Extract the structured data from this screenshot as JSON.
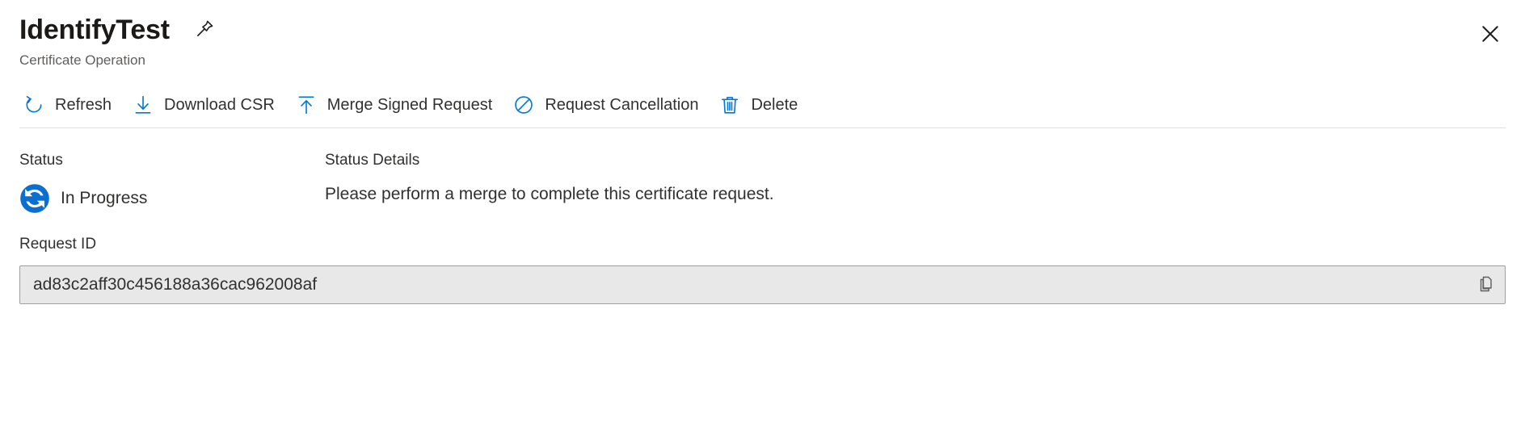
{
  "header": {
    "title": "IdentifyTest",
    "subtitle": "Certificate Operation",
    "pin_icon": "pin-icon",
    "close_icon": "close-icon"
  },
  "commandbar": {
    "buttons": [
      {
        "label": "Refresh",
        "icon": "refresh-icon"
      },
      {
        "label": "Download CSR",
        "icon": "download-icon"
      },
      {
        "label": "Merge Signed Request",
        "icon": "upload-icon"
      },
      {
        "label": "Request Cancellation",
        "icon": "prohibition-icon"
      },
      {
        "label": "Delete",
        "icon": "trash-icon"
      }
    ]
  },
  "main": {
    "status": {
      "label": "Status",
      "value": "In Progress",
      "icon": "in-progress-sync-icon"
    },
    "status_details": {
      "label": "Status Details",
      "text": "Please perform a merge to complete this certificate request."
    },
    "request_id": {
      "label": "Request ID",
      "value": "ad83c2aff30c456188a36cac962008af",
      "copy_icon": "copy-icon"
    }
  },
  "colors": {
    "accent": "#0078d4",
    "status_blue": "#0b6fd1",
    "text": "#323130",
    "muted": "#605e5c",
    "field_bg": "#e8e8e8",
    "field_border": "#a19f9d",
    "divider": "#e1dfdd"
  }
}
